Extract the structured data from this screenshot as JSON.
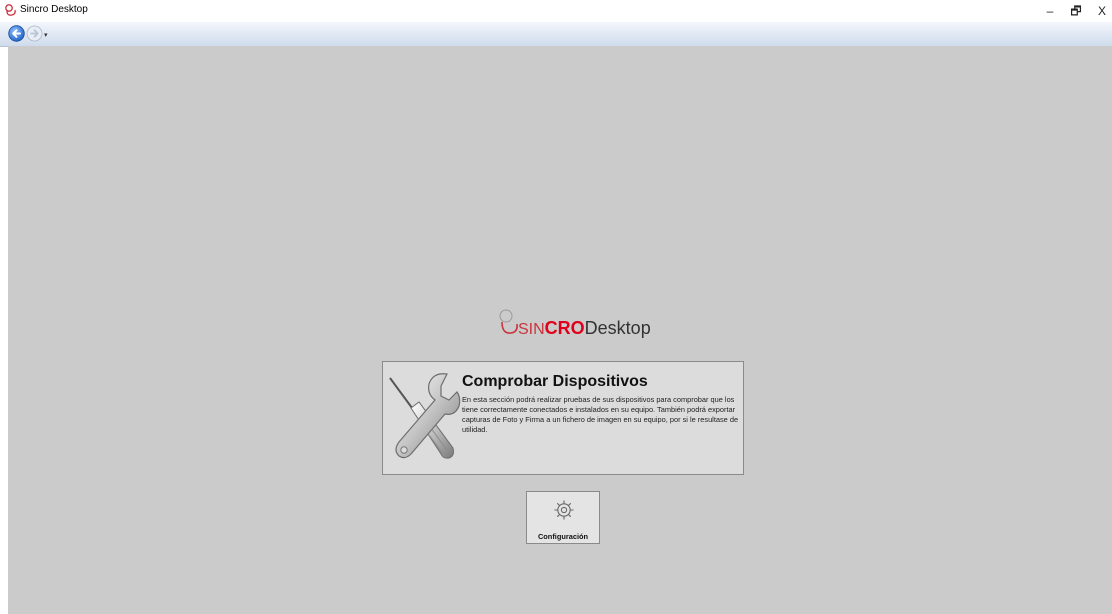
{
  "window": {
    "title": "Sincro Desktop",
    "minimize_glyph": "–",
    "maximize_glyph": "🗗",
    "close_glyph": "X"
  },
  "nav": {
    "back_icon": "back-arrow-icon",
    "forward_icon": "forward-arrow-icon",
    "dropdown_glyph": "▾"
  },
  "logo": {
    "sin": "SIN",
    "cro": "CRO",
    "desktop": "Desktop"
  },
  "card": {
    "title": "Comprobar Dispositivos",
    "description": "En esta sección podrá realizar pruebas de sus dispositivos para comprobar que los tiene correctamente conectados e instalados en su equipo. También podrá exportar capturas de Foto y Firma a un fichero de imagen en su equipo, por si le resultase de utilidad.",
    "icon": "tools-icon"
  },
  "config": {
    "label": "Configuración",
    "icon": "gear-icon"
  },
  "colors": {
    "content_bg": "#cbcbcb",
    "accent_red": "#e0001b",
    "nav_blue": "#2f6fd0"
  }
}
